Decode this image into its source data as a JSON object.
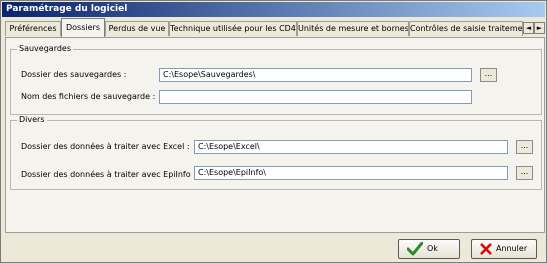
{
  "window": {
    "title": "Paramétrage du logiciel"
  },
  "tabs": [
    {
      "label": "Préférences"
    },
    {
      "label": "Dossiers"
    },
    {
      "label": "Perdus de vue"
    },
    {
      "label": "Technique utilisée pour les CD4"
    },
    {
      "label": "Unités de mesure et bornes"
    },
    {
      "label": "Contrôles de saisie traitement"
    }
  ],
  "tab_scroll": {
    "left": "◄",
    "right": "►"
  },
  "sauvegardes": {
    "title": "Sauvegardes",
    "dossier_label": "Dossier des sauvegardes :",
    "dossier_value": "C:\\Esope\\Sauvegardes\\",
    "browse": "...",
    "noms_label": "Nom des fichiers de sauvegarde :",
    "noms_value": ""
  },
  "divers": {
    "title": "Divers",
    "excel_label": "Dossier des données à traiter avec Excel :",
    "excel_value": "C:\\Esope\\Excel\\",
    "epiinfo_label": "Dossier des données à traiter avec EpiInfo :",
    "epiinfo_value": "C:\\Esope\\EpiInfo\\",
    "browse": "..."
  },
  "buttons": {
    "ok": "Ok",
    "cancel": "Annuler"
  },
  "colors": {
    "title_start": "#0a246a",
    "title_end": "#a6caf0",
    "ok_check": "#2e8b2e",
    "cancel_x": "#cc1111"
  }
}
